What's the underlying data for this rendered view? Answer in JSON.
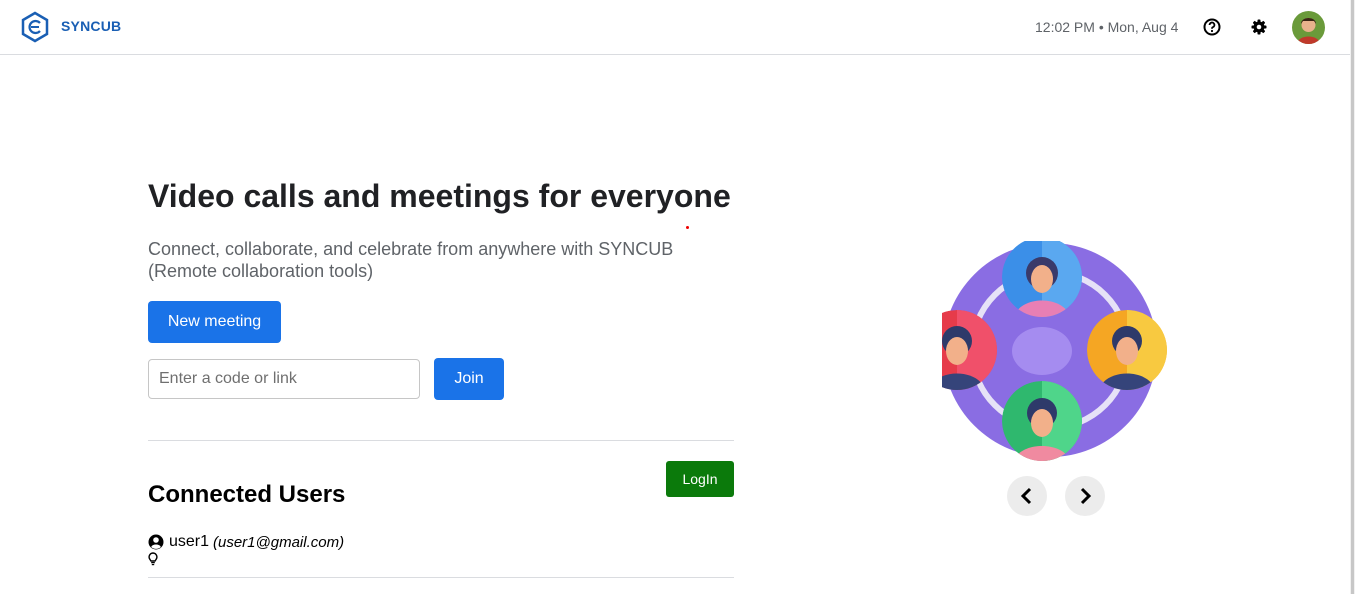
{
  "header": {
    "brand": "SYNCUB",
    "datetime": "12:02 PM • Mon, Aug 4",
    "icons": [
      "help-icon",
      "settings-icon",
      "avatar"
    ]
  },
  "hero": {
    "title": "Video calls and meetings for everyone",
    "subtitle": "Connect, collaborate, and celebrate from anywhere with SYNCUB (Remote collaboration tools)",
    "new_meeting_label": "New meeting",
    "code_placeholder": "Enter a code or link",
    "join_label": "Join"
  },
  "connected": {
    "login_label": "LogIn",
    "title": "Connected Users",
    "users": [
      {
        "name": "user1",
        "email": "(user1@gmail.com)"
      }
    ]
  },
  "carousel": {
    "prev_icon": "chevron-left-icon",
    "next_icon": "chevron-right-icon"
  },
  "colors": {
    "primary": "#1a73e8",
    "brand": "#1a5fb4",
    "login": "#0b7a0b",
    "illustration_bg": "#8a6de3"
  }
}
